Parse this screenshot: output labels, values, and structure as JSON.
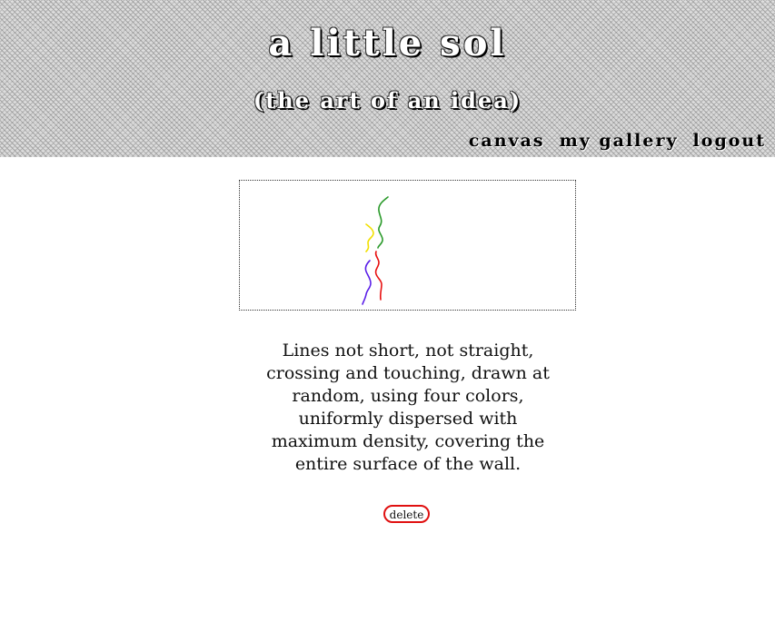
{
  "header": {
    "title": "a little sol",
    "subtitle": "(the art of an idea)",
    "nav": {
      "canvas": "canvas",
      "gallery": "my gallery",
      "logout": "logout"
    }
  },
  "artwork": {
    "line_colors": [
      "#2a9a2a",
      "#f2e000",
      "#e81010",
      "#5a1ee8"
    ]
  },
  "instructions": "Lines not short, not straight, crossing and touching, drawn at random, using four colors, uniformly dispersed with maximum density, covering the entire surface of the wall.",
  "delete_label": "delete"
}
